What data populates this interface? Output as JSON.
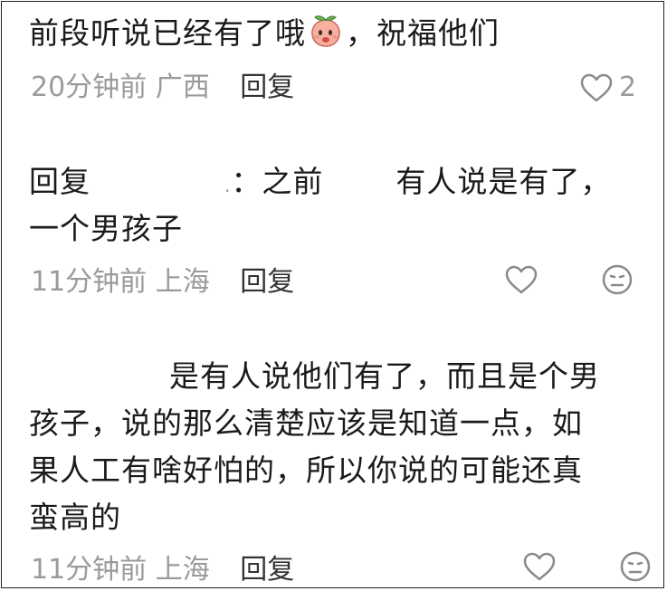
{
  "comments": [
    {
      "text_before_emoji": "前段听说已经有了哦",
      "emoji": "peach-emoji",
      "text_after_emoji": "，祝福他们",
      "time": "20分钟前",
      "location": "广西",
      "reply_label": "回复",
      "likes": "2"
    },
    {
      "reply_prefix": "回复",
      "colon": "：",
      "text_part1": "之前",
      "text_part2": "有人说是有了，",
      "text_line2": "一个男孩子",
      "time": "11分钟前",
      "location": "上海",
      "reply_label": "回复"
    },
    {
      "text_line1": "是有人说他们有了，而且是个男",
      "text_line2": "孩子，说的那么清楚应该是知道一点，如",
      "text_line3": "果人工有啥好怕的，所以你说的可能还真",
      "text_line4": "蛮高的",
      "time": "11分钟前",
      "location": "上海",
      "reply_label": "回复"
    }
  ],
  "colors": {
    "text": "#1a1a1a",
    "meta": "#9a9a9a",
    "icon": "#8a8a8a"
  }
}
